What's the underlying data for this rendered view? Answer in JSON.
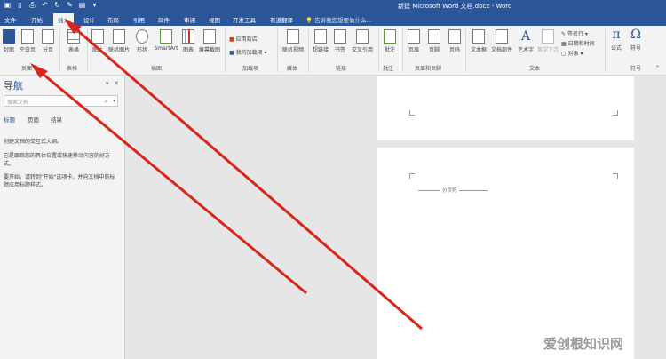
{
  "window": {
    "title": "新建 Microsoft Word 文档.docx - Word"
  },
  "tabs": [
    "文件",
    "开始",
    "插入",
    "设计",
    "布局",
    "引用",
    "邮件",
    "审阅",
    "视图",
    "开发工具",
    "有道翻译"
  ],
  "active_tab": "插入",
  "tell_me": "告诉我您想要做什么...",
  "ribbon": {
    "groups": [
      "页面",
      "表格",
      "插图",
      "加载项",
      "媒体",
      "链接",
      "批注",
      "页眉和页脚",
      "文本",
      "符号"
    ],
    "pages": [
      "封面",
      "空白页",
      "分页"
    ],
    "table": "表格",
    "illustrations": [
      "图片",
      "联机图片",
      "形状",
      "SmartArt",
      "图表",
      "屏幕截图"
    ],
    "addins": [
      "应用商店",
      "我的加载项"
    ],
    "media": "联机视频",
    "links": [
      "超链接",
      "书签",
      "交叉引用"
    ],
    "comment": "批注",
    "header_footer": [
      "页眉",
      "页脚",
      "页码"
    ],
    "text": [
      "文本框",
      "文档部件",
      "艺术字",
      "首字下沉"
    ],
    "text_small": [
      "签名行",
      "日期和时间",
      "对象"
    ],
    "symbols": [
      "公式",
      "符号"
    ],
    "symbol_glyphs": [
      "π",
      "Ω",
      "A"
    ]
  },
  "nav": {
    "title": "导航",
    "search_placeholder": "搜索文档",
    "tabs": [
      "标题",
      "页面",
      "结果"
    ],
    "active_tab": "标题",
    "text1": "创建文档的交互式大纲。",
    "text2": "它是跟踪您的具体位置或快速移动内容的好方式。",
    "text3": "要开始，请转到\"开始\"选项卡，并向文档中的标题应用标题样式。"
  },
  "document": {
    "page_break_label": "分页符"
  },
  "watermark": "爱创根知识网",
  "colors": {
    "accent": "#2b579a",
    "arrow": "#d9261c"
  }
}
